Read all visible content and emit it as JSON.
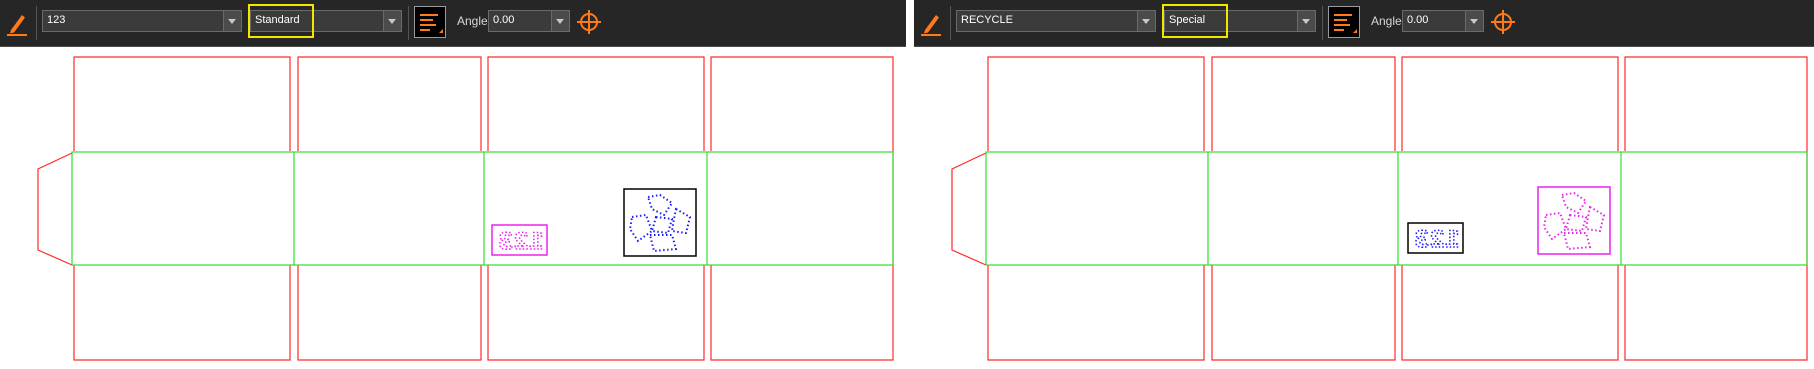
{
  "left_panel": {
    "text_value": "123",
    "font_style": "Standard",
    "angle_label": "Angle",
    "angle_value": "0.00"
  },
  "right_panel": {
    "text_value": "RECYCLE",
    "font_style": "Special",
    "angle_label": "Angle",
    "angle_value": "0.00"
  },
  "icons": [
    "pencil-icon",
    "align-icon",
    "target-icon",
    "recycle-symbol"
  ],
  "colors": {
    "toolbar_bg": "#262626",
    "cut_line": "#ff2a2a",
    "crease_line": "#33dd33",
    "highlight": "#f2e600",
    "accent": "#ff7a1a",
    "blue_dots": "#1a1aff",
    "magenta_dots": "#ee22ee"
  }
}
